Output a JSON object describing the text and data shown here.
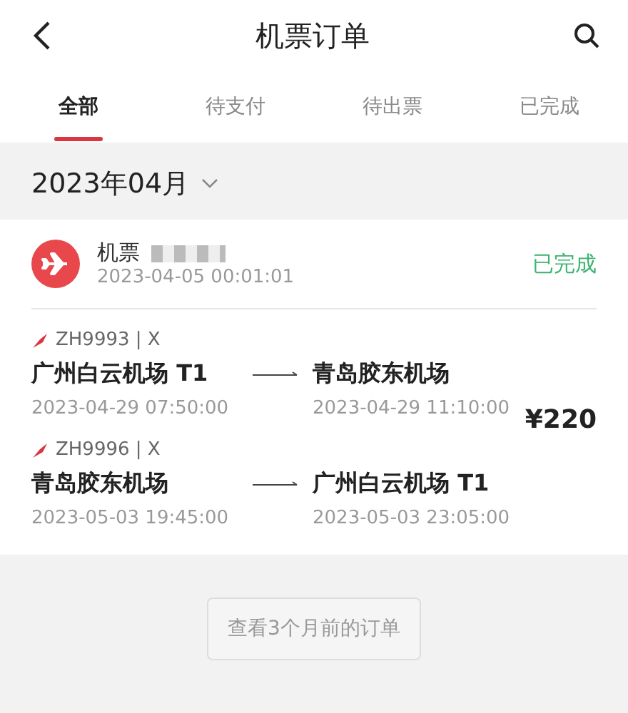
{
  "header": {
    "title": "机票订单"
  },
  "tabs": [
    {
      "label": "全部",
      "selected": true
    },
    {
      "label": "待支付",
      "selected": false
    },
    {
      "label": "待出票",
      "selected": false
    },
    {
      "label": "已完成",
      "selected": false
    }
  ],
  "month": "2023年04月",
  "order": {
    "type": "机票",
    "time": "2023-04-05 00:01:01",
    "status": "已完成",
    "price": "¥220",
    "flights": [
      {
        "number": "ZH9993 | X",
        "from": "广州白云机场 T1",
        "to": "青岛胶东机场",
        "depart": "2023-04-29 07:50:00",
        "arrive": "2023-04-29 11:10:00"
      },
      {
        "number": "ZH9996 | X",
        "from": "青岛胶东机场",
        "to": "广州白云机场 T1",
        "depart": "2023-05-03 19:45:00",
        "arrive": "2023-05-03 23:05:00"
      }
    ]
  },
  "older_button": "查看3个月前的订单"
}
